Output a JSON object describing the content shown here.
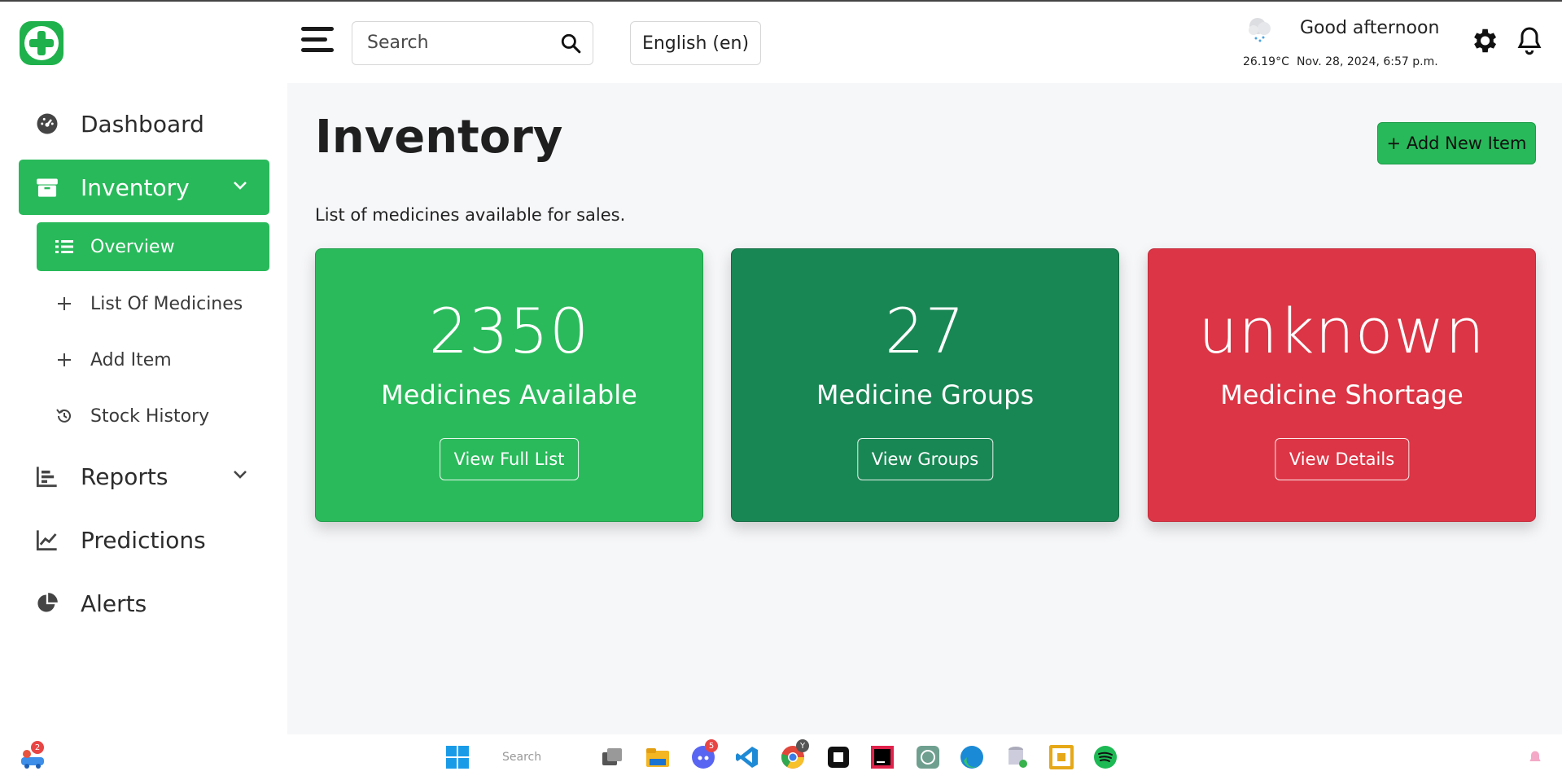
{
  "header": {
    "search_placeholder": "Search",
    "language": "English (en)",
    "temperature": "26.19°C",
    "greeting": "Good afternoon",
    "datetime": "Nov. 28, 2024, 6:57 p.m."
  },
  "sidebar": {
    "items": [
      {
        "label": "Dashboard",
        "icon": "gauge-icon"
      },
      {
        "label": "Inventory",
        "icon": "box-icon",
        "active": true
      },
      {
        "label": "Reports",
        "icon": "bar-chart-icon"
      },
      {
        "label": "Predictions",
        "icon": "line-chart-icon"
      },
      {
        "label": "Alerts",
        "icon": "pie-chart-icon"
      }
    ],
    "sub_items": [
      {
        "label": "Overview",
        "icon": "list-icon",
        "active": true
      },
      {
        "label": "List Of Medicines",
        "icon": "plus-icon"
      },
      {
        "label": "Add Item",
        "icon": "plus-icon"
      },
      {
        "label": "Stock History",
        "icon": "history-icon"
      }
    ]
  },
  "main": {
    "title": "Inventory",
    "add_button": "+ Add New Item",
    "subtitle": "List of medicines available for sales.",
    "cards": [
      {
        "value": "2350",
        "label": "Medicines Available",
        "button": "View Full List",
        "color": "#2aba5b"
      },
      {
        "value": "27",
        "label": "Medicine Groups",
        "button": "View Groups",
        "color": "#198754"
      },
      {
        "value": "unknown",
        "label": "Medicine Shortage",
        "button": "View Details",
        "color": "#dc3545"
      }
    ]
  },
  "taskbar": {
    "search_label": "Search",
    "app_badge": "2",
    "discord_badge": "5",
    "chrome_badge": "Y"
  }
}
